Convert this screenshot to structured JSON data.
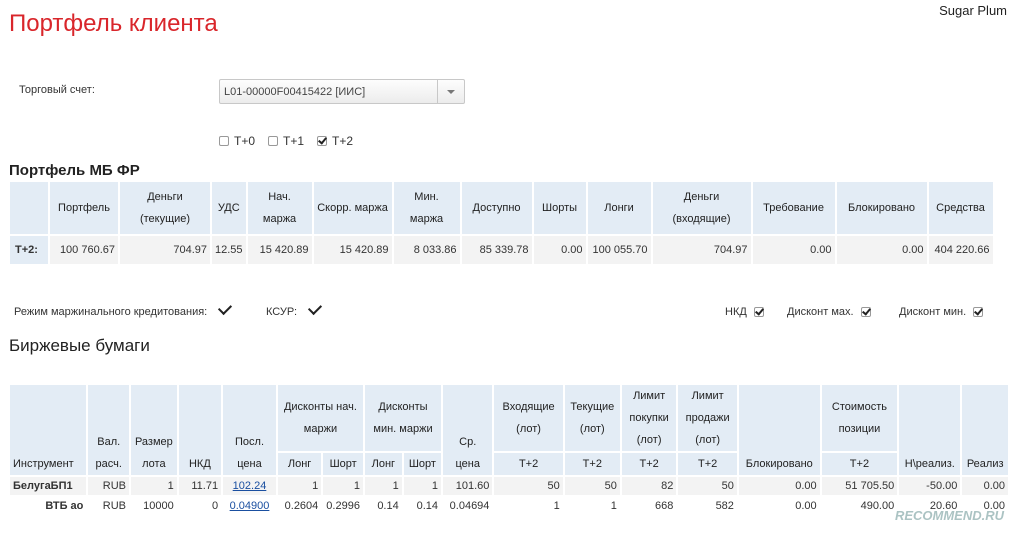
{
  "header": {
    "title": "Портфель клиента",
    "user": "Sugar Plum"
  },
  "account": {
    "label": "Торговый счет:",
    "selected": "L01-00000F00415422 [ИИС]"
  },
  "settlement": [
    {
      "label": "T+0",
      "checked": false
    },
    {
      "label": "T+1",
      "checked": false
    },
    {
      "label": "T+2",
      "checked": true
    }
  ],
  "portfolio": {
    "title": "Портфель МБ ФР",
    "headers": [
      "Портфель",
      "Деньги (текущие)",
      "УДС",
      "Нач. маржа",
      "Скорр. маржа",
      "Мин. маржа",
      "Доступно",
      "Шорты",
      "Лонги",
      "Деньги (входящие)",
      "Требование",
      "Блокировано",
      "Средства"
    ],
    "row_label": "T+2:",
    "values": [
      "100 760.67",
      "704.97",
      "12.55",
      "15 420.89",
      "15 420.89",
      "8 033.86",
      "85 339.78",
      "0.00",
      "100 055.70",
      "704.97",
      "0.00",
      "0.00",
      "404 220.66"
    ]
  },
  "options": {
    "margin_lending": "Режим маржинального кредитования:",
    "ksur": "КСУР:",
    "nkd": "НКД",
    "discount_max": "Дисконт мах.",
    "discount_min": "Дисконт мин."
  },
  "securities": {
    "title": "Биржевые бумаги",
    "headers": {
      "instrument": "Инструмент",
      "currency": "Вал. расч.",
      "lot": "Размер лота",
      "nkd": "НКД",
      "last_price": "Посл. цена",
      "disc_init": "Дисконты нач. маржи",
      "disc_min": "Дисконты мин. маржи",
      "long": "Лонг",
      "short": "Шорт",
      "avg_price": "Ср. цена",
      "incoming": "Входящие (лот)",
      "current": "Текущие (лот)",
      "limit_buy": "Лимит покупки (лот)",
      "limit_sell": "Лимит продажи (лот)",
      "blocked": "Блокировано",
      "position_value": "Стоимость позиции",
      "t2": "T+2",
      "unrealized": "Н\\реализ.",
      "realized": "Реализ"
    },
    "rows": [
      {
        "name": "БелугаБП1",
        "cur": "RUB",
        "lot": "1",
        "nkd": "11.71",
        "last": "102.24",
        "dl": "1",
        "ds": "1",
        "ml": "1",
        "ms": "1",
        "avg": "101.60",
        "inc": "50",
        "curr": "50",
        "lb": "82",
        "ls": "50",
        "blk": "0.00",
        "val": "51 705.50",
        "unr": "-50.00",
        "real": "0.00"
      },
      {
        "name": "ВТБ ао",
        "cur": "RUB",
        "lot": "10000",
        "nkd": "0",
        "last": "0.04900",
        "dl": "0.2604",
        "ds": "0.2996",
        "ml": "0.14",
        "ms": "0.14",
        "avg": "0.04694",
        "inc": "1",
        "curr": "1",
        "lb": "668",
        "ls": "582",
        "blk": "0.00",
        "val": "490.00",
        "unr": "20.60",
        "real": "0.00"
      }
    ]
  },
  "watermark": "RECOMMEND.RU",
  "colors": {
    "title": "#d9262b",
    "header_bg": "#e3ecf5",
    "cell_bg": "#f3f3f3",
    "link": "#1a4fa0"
  }
}
